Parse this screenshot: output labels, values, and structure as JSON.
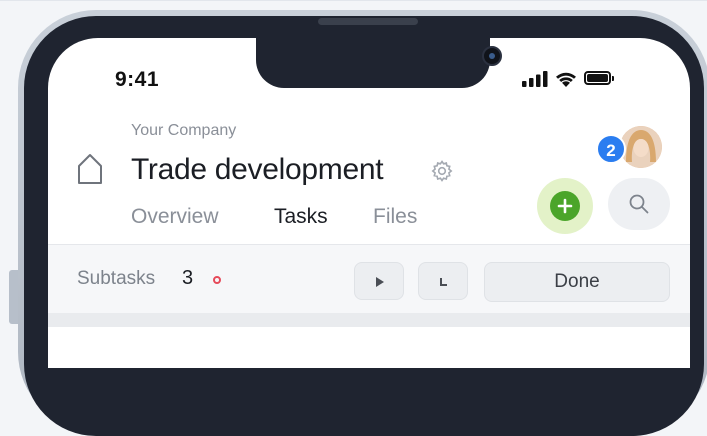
{
  "status_bar": {
    "time": "9:41",
    "icons": [
      "signal-icon",
      "wifi-icon",
      "battery-icon"
    ]
  },
  "header": {
    "company": "Your Company",
    "title": "Trade development",
    "icons": [
      "home-icon",
      "gear-icon"
    ]
  },
  "tabs": [
    {
      "label": "Overview",
      "active": false
    },
    {
      "label": "Tasks",
      "active": true
    },
    {
      "label": "Files",
      "active": false
    }
  ],
  "actions": {
    "notification_count": "2",
    "add_icon": "plus-icon",
    "search_icon": "search-icon"
  },
  "subtasks": {
    "label": "Subtasks",
    "count": "3",
    "controls": [
      "play-icon",
      "corner-icon"
    ],
    "done_label": "Done"
  },
  "colors": {
    "accent_green": "#4ba52a",
    "accent_green_bg": "#e3f2c8",
    "badge_blue": "#2b7df0",
    "alert_red": "#e64a5a",
    "frame": "#1f2430"
  }
}
